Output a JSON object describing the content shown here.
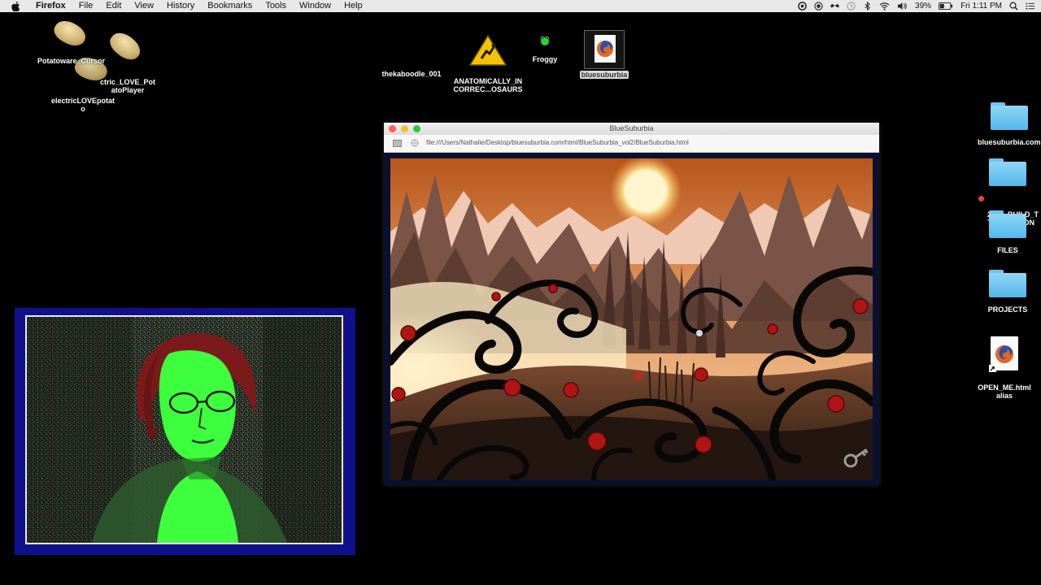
{
  "menubar": {
    "app": "Firefox",
    "items": [
      "File",
      "Edit",
      "View",
      "History",
      "Bookmarks",
      "Tools",
      "Window",
      "Help"
    ],
    "battery": "39%",
    "clock": "Fri 1:11 PM"
  },
  "desktop": {
    "left_icons": {
      "potatoware_cursor": "Potatoware_Cursor",
      "electric_love_potatoplayer": "ctric_LOVE_Pot\natoPlayer",
      "electric_love_potato": "electricLOVEpotat\no"
    },
    "top_icons": {
      "kaboodle": "thekaboodle_001",
      "anatomically": "ANATOMICALLY_IN\nCORREC...OSAURS",
      "froggy": "Froggy",
      "bluesuburbia": "bluesuburbia"
    },
    "right_icons": {
      "bluesuburbia_com": "bluesuburbia.com",
      "build_tragedon": "2015_BUILD_T\nTRAGEDDON",
      "files": "FILES",
      "projects": "PROJECTS",
      "open_me": "OPEN_ME.html\nalias"
    }
  },
  "browser": {
    "title": "BlueSuburbia",
    "url": "file:///Users/Nathalie/Desktop/bluesuburbia.com/html/BlueSuburbia_vol2/BlueSuburbia.html"
  },
  "colors": {
    "menubar_bg": "#e8e8e8",
    "folder_blue": "#5cbdee",
    "webcam_frame": "#10108c",
    "webcam_green": "#3dff3d",
    "sun": "#fff3c0",
    "rose": "#b01515"
  }
}
